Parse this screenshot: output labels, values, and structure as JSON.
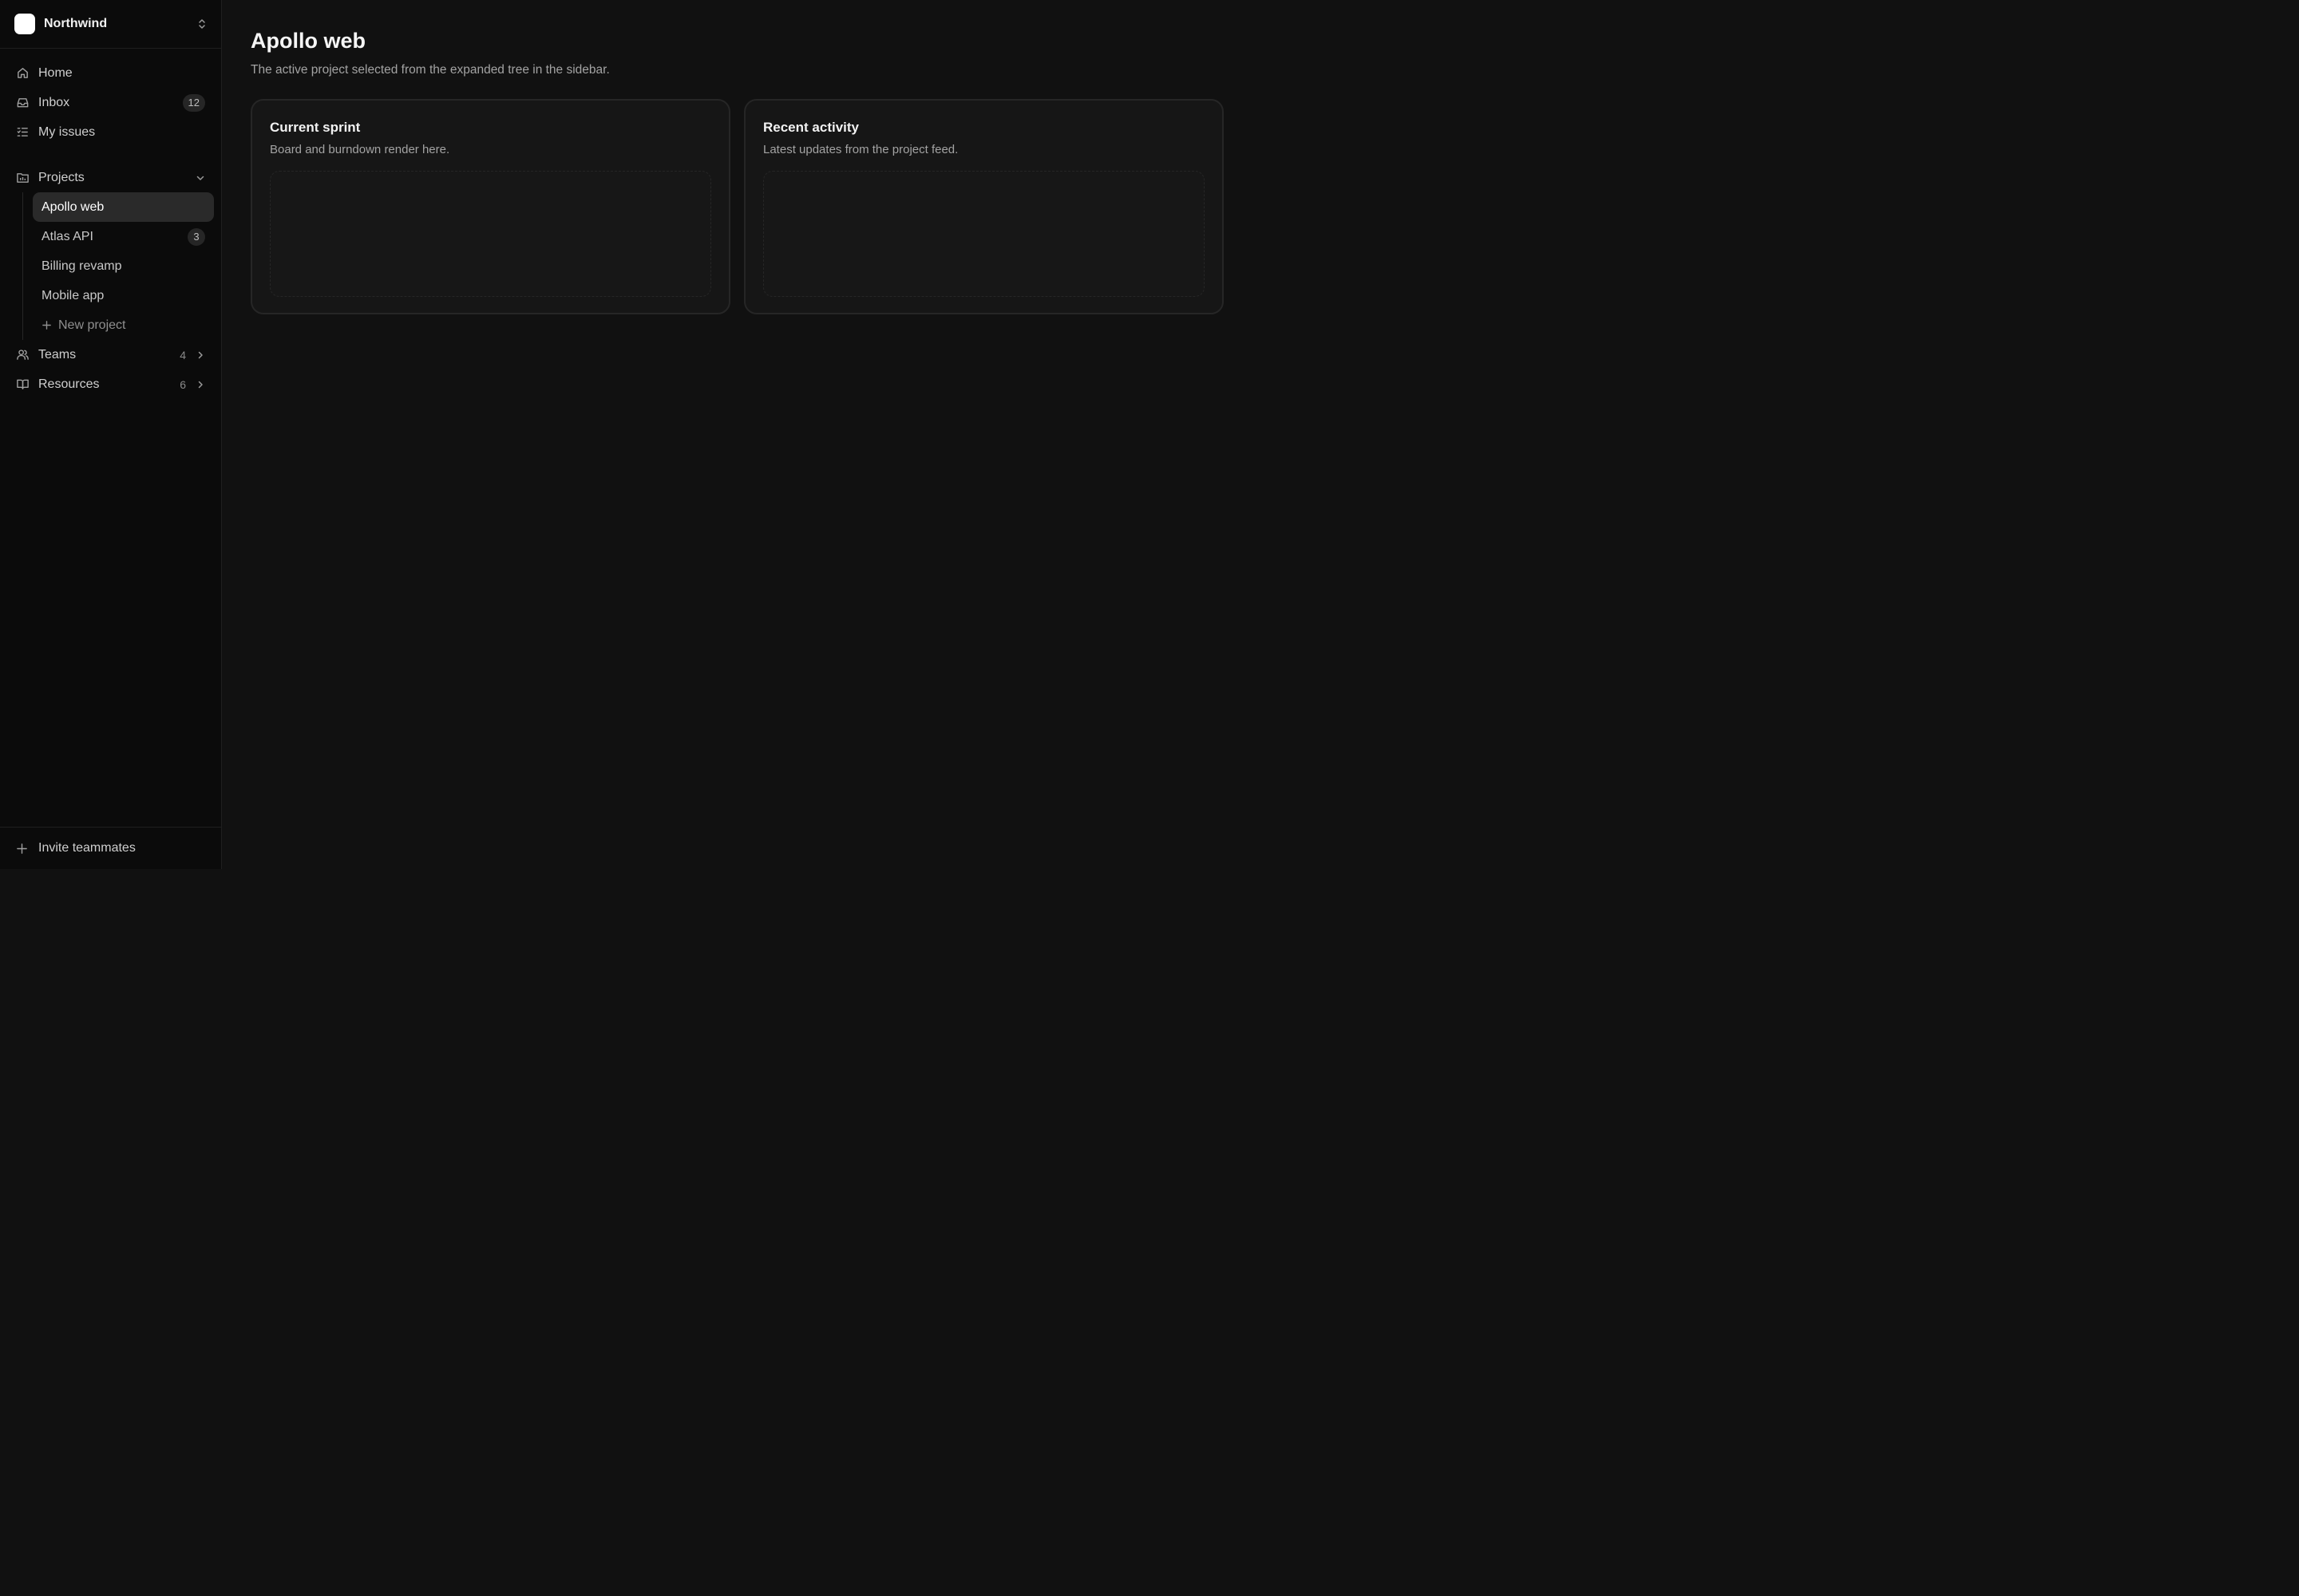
{
  "workspace": {
    "name": "Northwind"
  },
  "nav": {
    "home": "Home",
    "inbox": "Inbox",
    "inbox_badge": "12",
    "my_issues": "My issues",
    "projects": "Projects",
    "teams": "Teams",
    "teams_count": "4",
    "resources": "Resources",
    "resources_count": "6"
  },
  "projects": {
    "items": [
      {
        "label": "Apollo web",
        "active": true
      },
      {
        "label": "Atlas API",
        "badge": "3"
      },
      {
        "label": "Billing revamp"
      },
      {
        "label": "Mobile app"
      }
    ],
    "new_label": "New project"
  },
  "footer": {
    "invite_label": "Invite teammates"
  },
  "main": {
    "title": "Apollo web",
    "subtitle": "The active project selected from the expanded tree in the sidebar.",
    "cards": [
      {
        "title": "Current sprint",
        "subtitle": "Board and burndown render here."
      },
      {
        "title": "Recent activity",
        "subtitle": "Latest updates from the project feed."
      }
    ]
  }
}
